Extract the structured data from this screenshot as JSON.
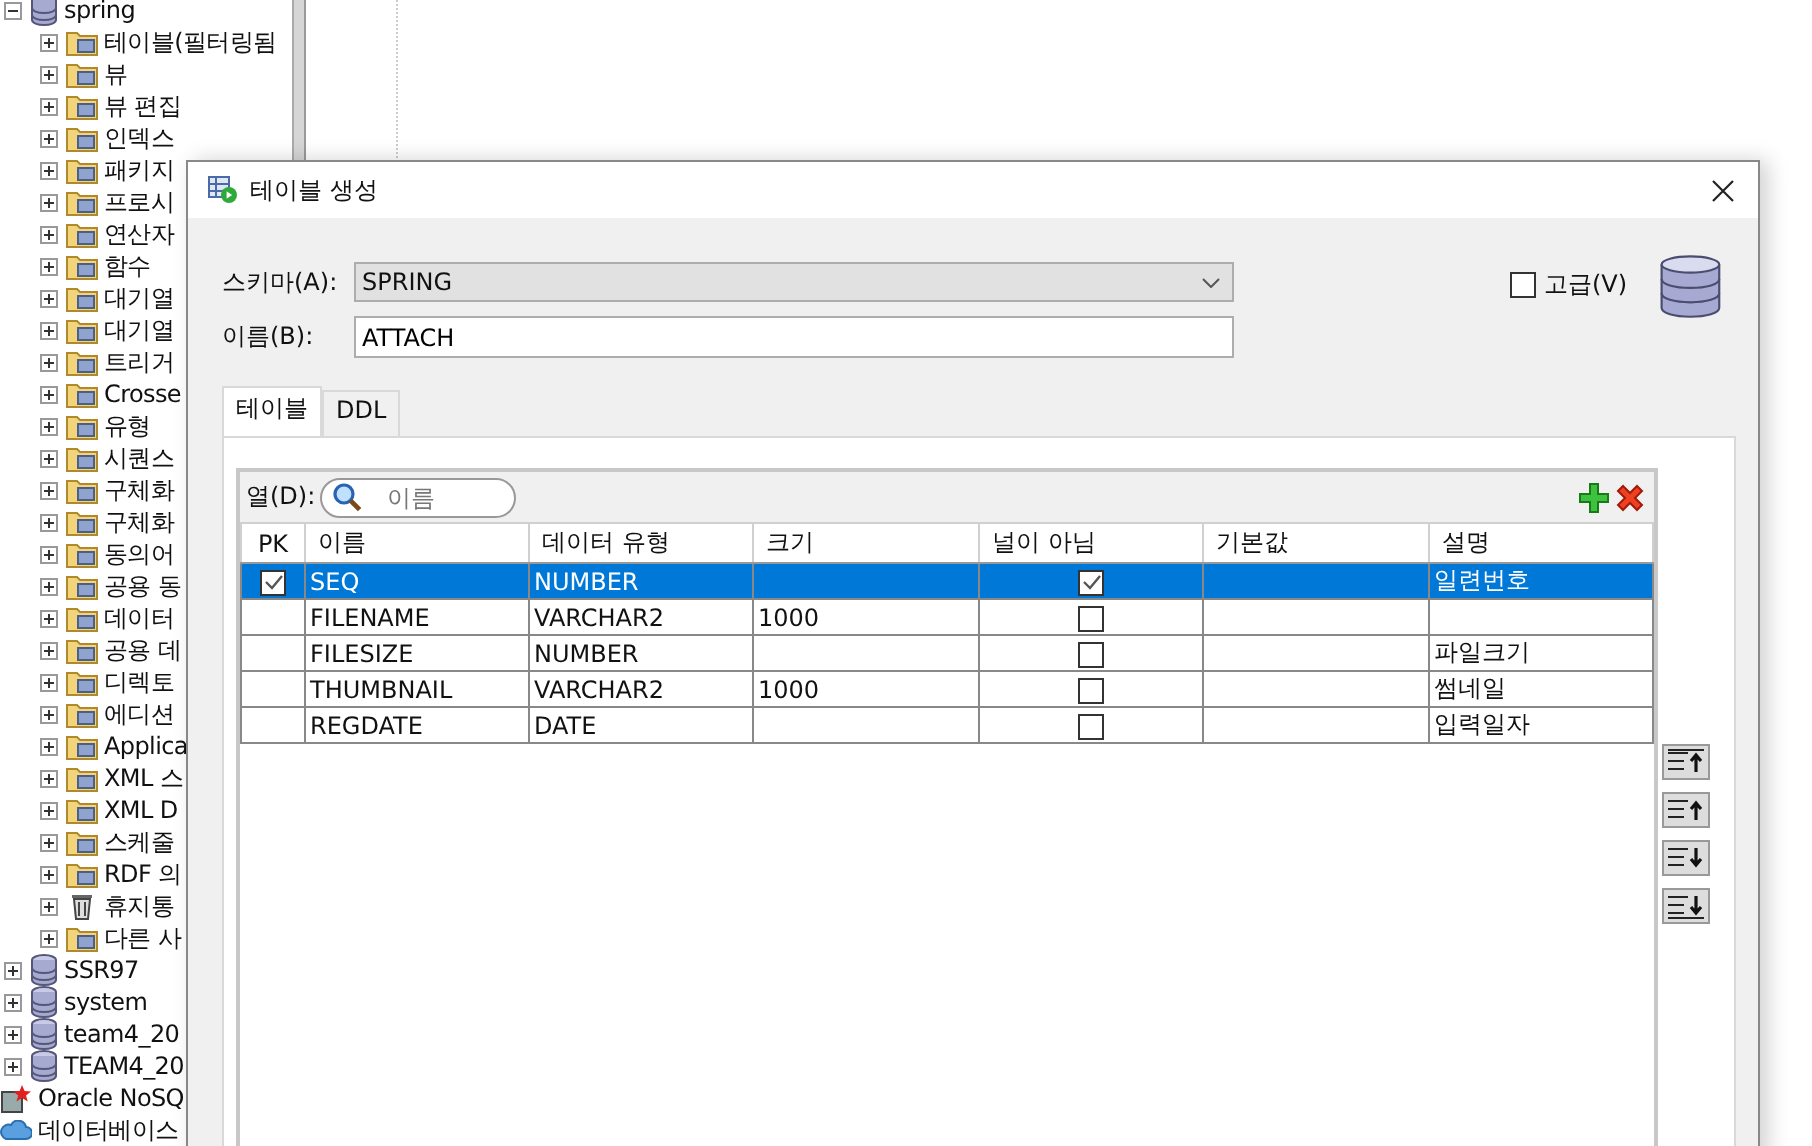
{
  "tree": [
    {
      "label": "spring",
      "kind": "database",
      "expanded": true,
      "children": [
        {
          "label": "테이블(필터링됨",
          "kind": "folder",
          "expanded": false
        },
        {
          "label": "뷰",
          "kind": "folder",
          "expanded": false
        },
        {
          "label": "뷰 편집",
          "kind": "folder",
          "expanded": false
        },
        {
          "label": "인덱스",
          "kind": "folder",
          "expanded": false
        },
        {
          "label": "패키지",
          "kind": "folder",
          "expanded": false
        },
        {
          "label": "프로시",
          "kind": "folder",
          "expanded": false
        },
        {
          "label": "연산자",
          "kind": "folder",
          "expanded": false
        },
        {
          "label": "함수",
          "kind": "folder",
          "expanded": false
        },
        {
          "label": "대기열",
          "kind": "folder",
          "expanded": false
        },
        {
          "label": "대기열",
          "kind": "folder",
          "expanded": false
        },
        {
          "label": "트리거",
          "kind": "folder",
          "expanded": false
        },
        {
          "label": "Crosse",
          "kind": "folder",
          "expanded": false
        },
        {
          "label": "유형",
          "kind": "folder",
          "expanded": false
        },
        {
          "label": "시퀀스",
          "kind": "folder",
          "expanded": false
        },
        {
          "label": "구체화",
          "kind": "folder",
          "expanded": false
        },
        {
          "label": "구체화",
          "kind": "folder",
          "expanded": false
        },
        {
          "label": "동의어",
          "kind": "folder",
          "expanded": false
        },
        {
          "label": "공용 동",
          "kind": "folder",
          "expanded": false
        },
        {
          "label": "데이터",
          "kind": "folder",
          "expanded": false
        },
        {
          "label": "공용 데",
          "kind": "folder",
          "expanded": false
        },
        {
          "label": "디렉토",
          "kind": "folder",
          "expanded": false
        },
        {
          "label": "에디션",
          "kind": "folder",
          "expanded": false
        },
        {
          "label": "Applica",
          "kind": "folder",
          "expanded": false
        },
        {
          "label": "XML 스",
          "kind": "folder",
          "expanded": false
        },
        {
          "label": "XML D",
          "kind": "folder",
          "expanded": false
        },
        {
          "label": "스케줄",
          "kind": "folder",
          "expanded": false
        },
        {
          "label": "RDF 의",
          "kind": "folder",
          "expanded": false
        },
        {
          "label": "휴지통",
          "kind": "trash",
          "expanded": false
        },
        {
          "label": "다른 사",
          "kind": "folder",
          "expanded": false
        }
      ]
    },
    {
      "label": "SSR97",
      "kind": "database",
      "expanded": false
    },
    {
      "label": "system",
      "kind": "database",
      "expanded": false
    },
    {
      "label": "team4_20",
      "kind": "database",
      "expanded": false
    },
    {
      "label": "TEAM4_20",
      "kind": "database",
      "expanded": false
    }
  ],
  "tree_roots": [
    {
      "label": "Oracle NoSQ",
      "kind": "nosql"
    },
    {
      "label": "데이터베이스",
      "kind": "cloud"
    }
  ],
  "dialog": {
    "title": "테이블 생성",
    "schema": {
      "label": "스키마(A):",
      "value": "SPRING"
    },
    "name": {
      "label": "이름(B):",
      "value": "ATTACH"
    },
    "advanced": {
      "label": "고급(V)",
      "checked": false
    },
    "tabs": [
      {
        "label": "테이블",
        "selected": true
      },
      {
        "label": "DDL",
        "selected": false
      }
    ],
    "column_filter": {
      "label": "열(D):",
      "placeholder": "이름"
    },
    "columns": [
      "PK",
      "이름",
      "데이터 유형",
      "크기",
      "널이 아님",
      "기본값",
      "설명"
    ],
    "rows": [
      {
        "selected": true,
        "pk": true,
        "name": "SEQ",
        "type": "NUMBER",
        "size": "",
        "not_null": true,
        "default": "",
        "description": "일련번호"
      },
      {
        "selected": false,
        "pk": false,
        "name": "FILENAME",
        "type": "VARCHAR2",
        "size": "1000",
        "not_null": false,
        "default": "",
        "description": ""
      },
      {
        "selected": false,
        "pk": false,
        "name": "FILESIZE",
        "type": "NUMBER",
        "size": "",
        "not_null": false,
        "default": "",
        "description": "파일크기"
      },
      {
        "selected": false,
        "pk": false,
        "name": "THUMBNAIL",
        "type": "VARCHAR2",
        "size": "1000",
        "not_null": false,
        "default": "",
        "description": "썸네일"
      },
      {
        "selected": false,
        "pk": false,
        "name": "REGDATE",
        "type": "DATE",
        "size": "",
        "not_null": false,
        "default": "",
        "description": "입력일자"
      }
    ]
  }
}
